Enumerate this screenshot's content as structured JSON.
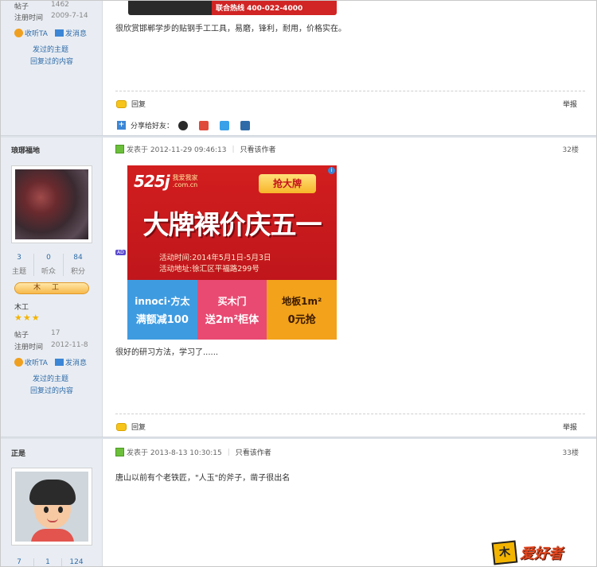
{
  "post1": {
    "user_stats": {
      "posts_label": "帖子",
      "posts_value": "1462",
      "reg_label": "注册时间",
      "reg_value": "2009-7-14"
    },
    "follow": "收听TA",
    "message": "发消息",
    "topics": "发过的主题",
    "replies": "回复过的内容",
    "text": "很欣赏邯郸学步的贴钢手工工具，易磨，锋利，耐用，价格实在。",
    "reply_label": "回复",
    "report_label": "举报",
    "share_label": "分享给好友："
  },
  "post2": {
    "username": "琅琊福地",
    "stats": [
      {
        "num": "3",
        "label": "主题"
      },
      {
        "num": "0",
        "label": "听众"
      },
      {
        "num": "84",
        "label": "积分"
      }
    ],
    "rank": "木工",
    "level_title": "木工",
    "stars_count": 3,
    "stars": "★★★",
    "posts_label": "帖子",
    "posts_value": "17",
    "reg_label": "注册时间",
    "reg_value": "2012-11-8",
    "follow": "收听TA",
    "message": "发消息",
    "topics": "发过的主题",
    "replies": "回复过的内容",
    "posted_at": "发表于 2012-11-29 09:46:13",
    "only_author": "只看该作者",
    "floor": "32楼",
    "text": "很好的研习方法，学习了......",
    "reply_label": "回复",
    "report_label": "举报",
    "ad": {
      "logo": "525j",
      "logo_sub1": "我爱我家",
      "logo_sub2": ".com.cn",
      "tag": "抢大牌",
      "title": "大牌裸价庆五一",
      "time_line": "活动时间:2014年5月1日-5月3日",
      "place_line": "活动地址:徐汇区平福路299号",
      "cells": [
        {
          "top": "innoci·方太",
          "bottom": "满额减100"
        },
        {
          "top": "买木门",
          "bottom": "送2m²柜体"
        },
        {
          "top": "地板1m²",
          "bottom": "0元抢"
        }
      ],
      "info": "i",
      "badge": "AD"
    }
  },
  "post3": {
    "username": "正是",
    "posted_at": "发表于 2013-8-13 10:30:15",
    "only_author": "只看该作者",
    "floor": "33楼",
    "text": "唐山以前有个老铁匠，\"人玉\"的斧子，凿子很出名",
    "stats": [
      {
        "num": "7"
      },
      {
        "num": "1"
      },
      {
        "num": "124"
      }
    ]
  },
  "branding": {
    "mark": "木工",
    "text": "爱好者"
  },
  "top_banner_text": "联合热线 400-022-4000"
}
